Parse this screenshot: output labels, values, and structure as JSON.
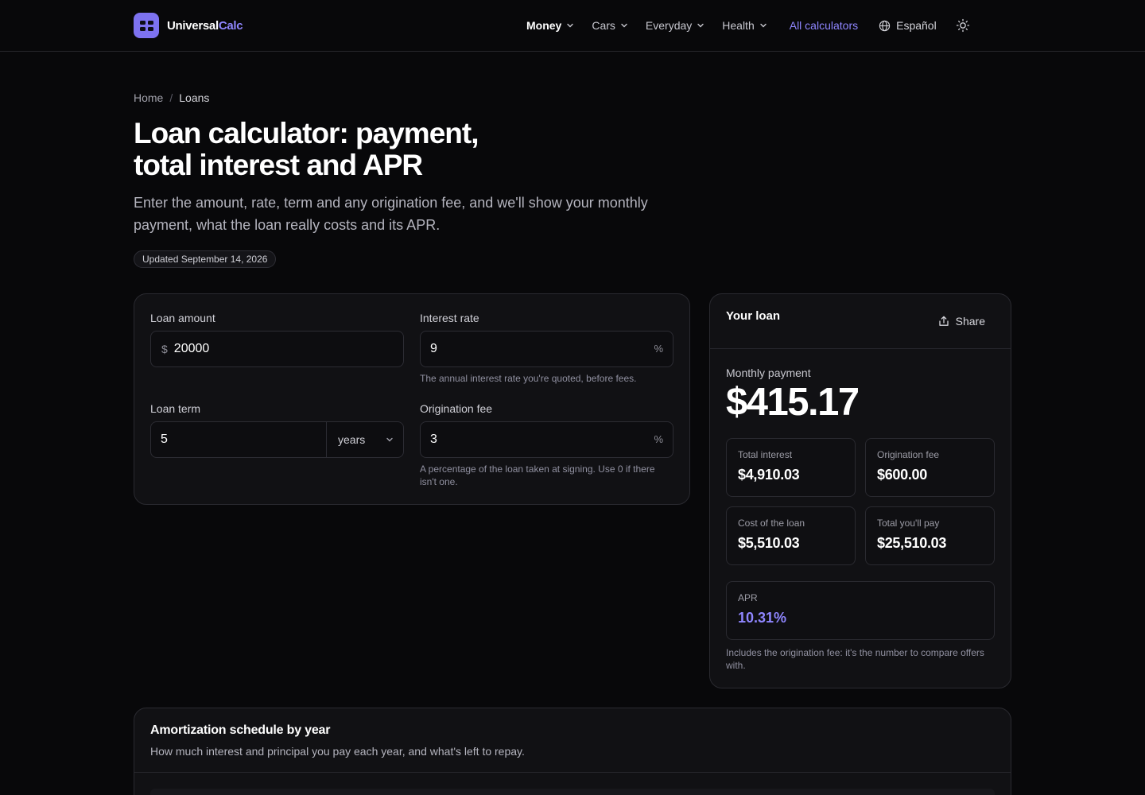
{
  "header": {
    "logo_prefix": "Universal",
    "logo_suffix": "Calc",
    "nav": [
      {
        "label": "Money",
        "active": true
      },
      {
        "label": "Cars"
      },
      {
        "label": "Everyday"
      },
      {
        "label": "Health"
      }
    ],
    "all_calculators": "All calculators",
    "language": "Español",
    "icons": {
      "logo": "grid-icon",
      "language": "globe-icon",
      "theme": "sun-icon",
      "chevron": "chevron-down-icon"
    }
  },
  "breadcrumb": {
    "home": "Home",
    "separator": "/",
    "current": "Loans"
  },
  "hero": {
    "title_line1": "Loan calculator: payment,",
    "title_line2": "total interest and APR",
    "subtitle": "Enter the amount, rate, term and any origination fee, and we'll show your monthly payment, what the loan really costs and its APR.",
    "updated": "Updated September 14, 2026"
  },
  "form": {
    "loan_amount": {
      "label": "Loan amount",
      "prefix": "$",
      "value": "20000"
    },
    "interest_rate": {
      "label": "Interest rate",
      "value": "9",
      "suffix": "%",
      "help": "The annual interest rate you're quoted, before fees."
    },
    "loan_term": {
      "label": "Loan term",
      "value": "5",
      "unit": "years"
    },
    "origination_fee": {
      "label": "Origination fee",
      "value": "3",
      "suffix": "%",
      "help": "A percentage of the loan taken at signing. Use 0 if there isn't one."
    }
  },
  "result": {
    "title": "Your loan",
    "share": "Share",
    "monthly_label": "Monthly payment",
    "monthly_value": "$415.17",
    "stats": [
      {
        "label": "Total interest",
        "value": "$4,910.03"
      },
      {
        "label": "Origination fee",
        "value": "$600.00"
      },
      {
        "label": "Cost of the loan",
        "value": "$5,510.03"
      },
      {
        "label": "Total you'll pay",
        "value": "$25,510.03"
      }
    ],
    "apr_label": "APR",
    "apr_value": "10.31%",
    "apr_note": "Includes the origination fee: it's the number to compare offers with.",
    "accent_color": "#8f86ff"
  },
  "amortization": {
    "title": "Amortization schedule by year",
    "subtitle": "How much interest and principal you pay each year, and what's left to repay."
  }
}
